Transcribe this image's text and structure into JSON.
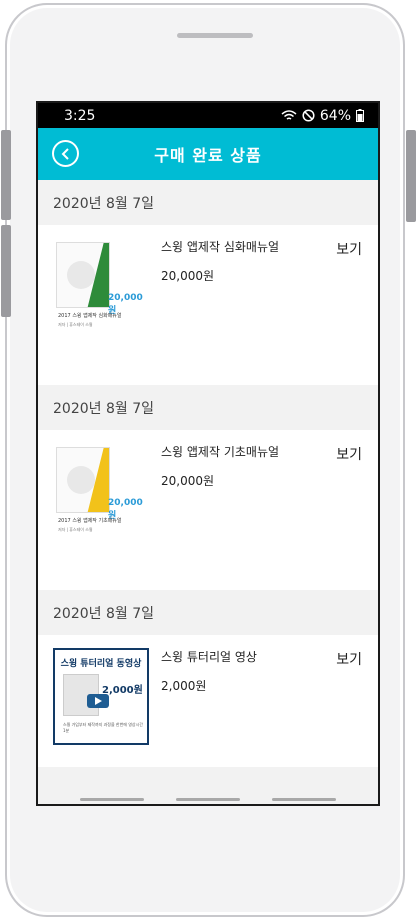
{
  "status": {
    "time": "3:25",
    "battery": "64%"
  },
  "appbar": {
    "title": "구매 완료 상품",
    "back_icon": "chevron-left-icon"
  },
  "purchases": [
    {
      "date": "2020년 8월 7일",
      "name": "스윙 앱제작 심화매뉴얼",
      "price": "20,000원",
      "view": "보기",
      "thumb": {
        "price": "20,000원",
        "title": "2017 스윙 앱제작 심화매뉴얼",
        "author": "저자 | 휴스테이 스윙",
        "accent": "#2e8b3a"
      }
    },
    {
      "date": "2020년 8월 7일",
      "name": "스윙 앱제작 기초매뉴얼",
      "price": "20,000원",
      "view": "보기",
      "thumb": {
        "price": "20,000원",
        "title": "2017 스윙 앱제작 기초매뉴얼",
        "author": "저자 | 휴스테이 스윙",
        "accent": "#f2c21a"
      }
    },
    {
      "date": "2020년 8월 7일",
      "name": "스윙 튜터리얼 영상",
      "price": "2,000원",
      "view": "보기",
      "thumb": {
        "title": "스윙 튜터리얼 동영상",
        "price": "2,000원",
        "desc": "스윙 가입부터 제작까지 과정을 한번에 영상시간 1분"
      }
    }
  ],
  "colors": {
    "appbar": "#00bcd4",
    "date_bg": "#f2f2f2",
    "thumb_price": "#2b9bd7"
  }
}
